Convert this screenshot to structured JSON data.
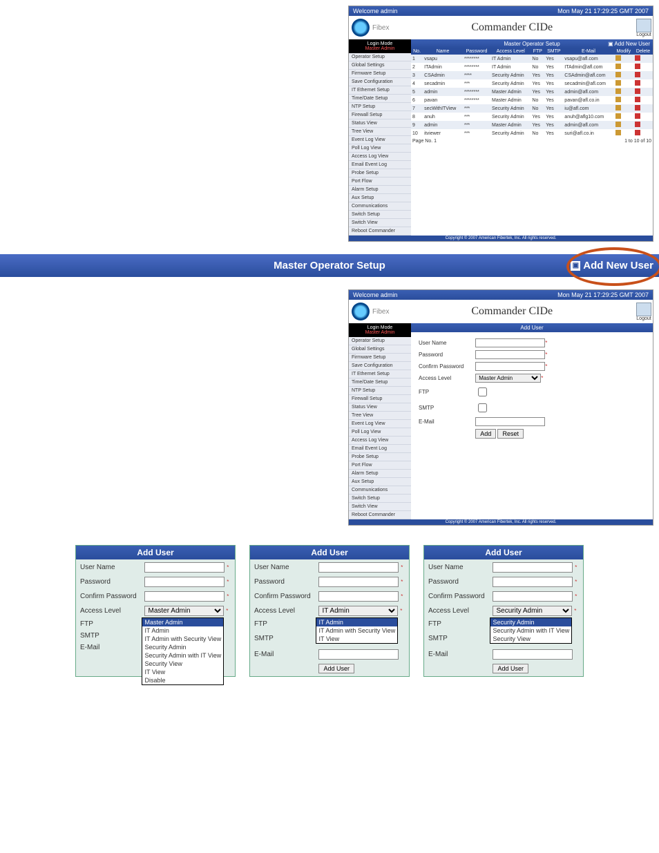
{
  "brand": "Fibex",
  "app_title": "Commander CIDe",
  "welcome": "Welcome admin",
  "timestamp": "Mon May 21 17:29:25 GMT 2007",
  "logout": "Logout",
  "login_mode_label": "Login Mode",
  "login_mode_value": "Master Admin",
  "sidebar1": [
    "Operator Setup",
    "Global Settings",
    "Firmware Setup",
    "Save Configuration",
    "IT Ethernet Setup",
    "Time/Date Setup",
    "NTP Setup",
    "Firewall Setup",
    "Status View",
    "Tree View",
    "Event Log View",
    "Poll Log View",
    "Access Log View",
    "Email Event Log",
    "Probe Setup",
    "Port Flow",
    "Alarm Setup",
    "Aux Setup",
    "Communications",
    "Switch Setup",
    "Switch View",
    "Reboot Commander"
  ],
  "mos_title": "Master Operator Setup",
  "add_new_user": "Add New User",
  "add_user_title": "Add User",
  "table": {
    "headers": [
      "No.",
      "Name",
      "Password",
      "Access Level",
      "FTP",
      "SMTP",
      "E-Mail",
      "Modify",
      "Delete"
    ],
    "rows": [
      [
        "1",
        "vsapu",
        "********",
        "IT Admin",
        "No",
        "Yes",
        "vsapu@afl.com"
      ],
      [
        "2",
        "ITAdmin",
        "********",
        "IT Admin",
        "No",
        "Yes",
        "ITAdmin@afl.com"
      ],
      [
        "3",
        "CSAdmin",
        "****",
        "Security Admin",
        "Yes",
        "Yes",
        "CSAdmin@afl.com"
      ],
      [
        "4",
        "secadmin",
        "***",
        "Security Admin",
        "Yes",
        "Yes",
        "secadmin@afl.com"
      ],
      [
        "5",
        "admin",
        "********",
        "Master Admin",
        "Yes",
        "Yes",
        "admin@afl.com"
      ],
      [
        "6",
        "pavan",
        "********",
        "Master Admin",
        "No",
        "Yes",
        "pavan@afl.co.in"
      ],
      [
        "7",
        "secWithITView",
        "***",
        "Security Admin",
        "No",
        "Yes",
        "iu@afl.com"
      ],
      [
        "8",
        "anuh",
        "***",
        "Security Admin",
        "Yes",
        "Yes",
        "anuh@aflg10.com"
      ],
      [
        "9",
        "admin",
        "***",
        "Master Admin",
        "Yes",
        "Yes",
        "admin@afl.com"
      ],
      [
        "10",
        "itviewer",
        "***",
        "Security Admin",
        "No",
        "Yes",
        "suri@afl.co.in"
      ]
    ],
    "footer": "1 to 10 of 10",
    "page": "Page No. 1"
  },
  "form": {
    "username": "User Name",
    "password": "Password",
    "confirm": "Confirm Password",
    "access": "Access Level",
    "ftp": "FTP",
    "smtp": "SMTP",
    "email": "E-Mail",
    "add": "Add",
    "reset": "Reset",
    "adduser": "Add User"
  },
  "master_opts": [
    "Master Admin",
    "IT Admin",
    "IT Admin with Security View",
    "Security Admin",
    "Security Admin with IT View",
    "Security View",
    "IT View",
    "Disable"
  ],
  "it_opts": [
    "IT Admin",
    "IT Admin with Security View",
    "IT View"
  ],
  "sec_opts": [
    "Security Admin",
    "Security Admin with IT View",
    "Security View"
  ],
  "copyright": "Copyright © 2007 American Fibertek, Inc. All rights reserved."
}
